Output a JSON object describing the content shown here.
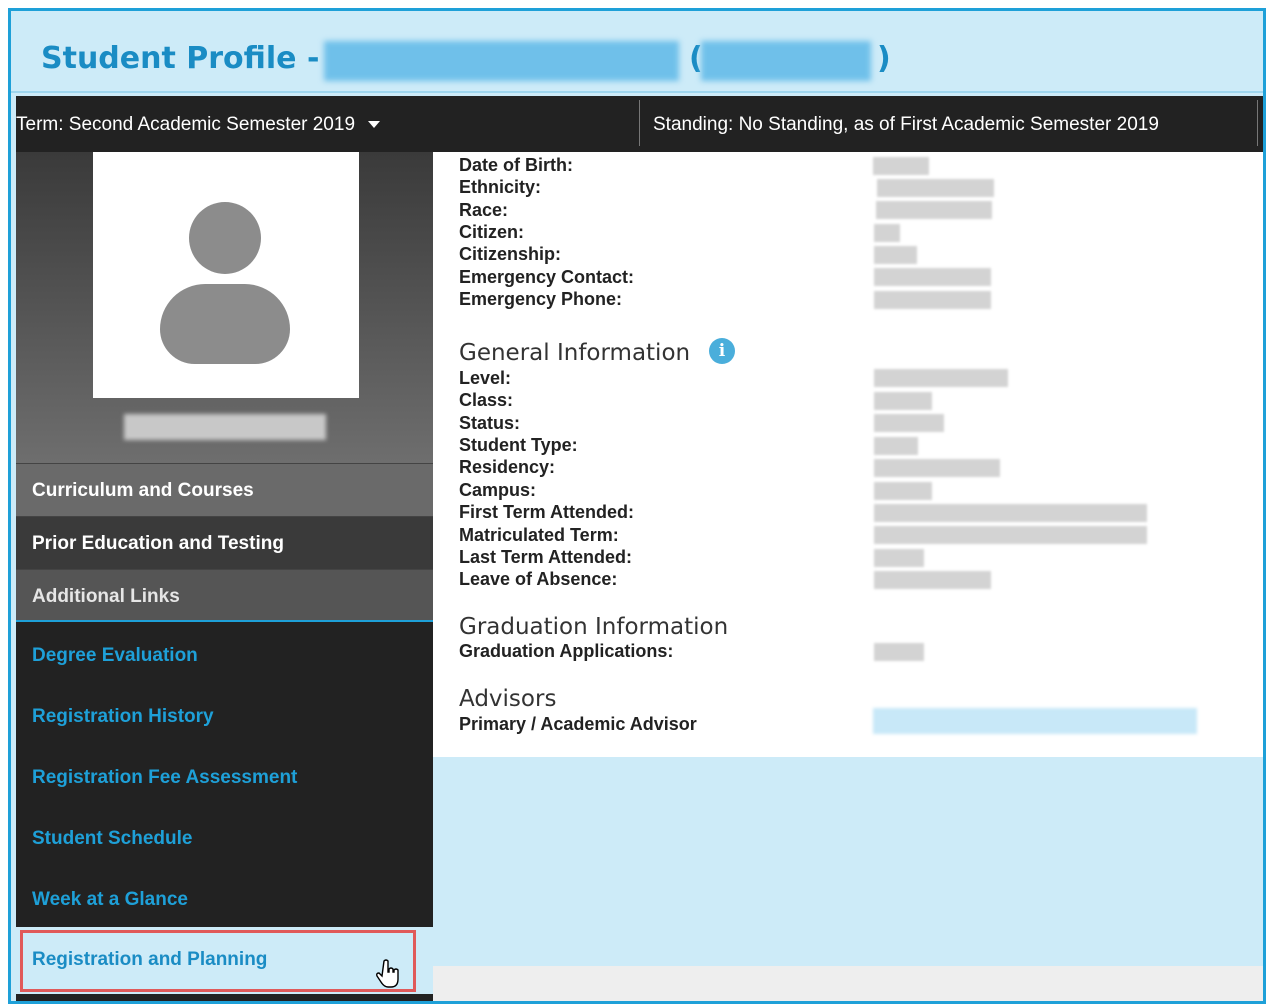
{
  "header": {
    "title_prefix": "Student Profile -",
    "paren_open": "(",
    "paren_close": ")"
  },
  "info_bar": {
    "term_label": "Term:",
    "term_value": "Second Academic Semester 2019",
    "standing_label": "Standing:",
    "standing_value": "No Standing, as of First Academic Semester 2019"
  },
  "sidebar": {
    "buttons": [
      "Curriculum and Courses",
      "Prior Education and Testing",
      "Additional Links"
    ],
    "links": [
      "Degree Evaluation",
      "Registration History",
      "Registration Fee Assessment",
      "Student Schedule",
      "Week at a Glance",
      "Registration and Planning"
    ]
  },
  "personal": {
    "labels": [
      "Date of Birth:",
      "Ethnicity:",
      "Race:",
      "Citizen:",
      "Citizenship:",
      "Emergency Contact:",
      "Emergency Phone:"
    ]
  },
  "general": {
    "heading": "General Information",
    "info_icon": "i",
    "labels": [
      "Level:",
      "Class:",
      "Status:",
      "Student Type:",
      "Residency:",
      "Campus:",
      "First Term Attended:",
      "Matriculated Term:",
      "Last Term Attended:",
      "Leave of Absence:"
    ]
  },
  "graduation": {
    "heading": "Graduation Information",
    "labels": [
      "Graduation Applications:"
    ]
  },
  "advisors": {
    "heading": "Advisors",
    "labels": [
      "Primary / Academic Advisor"
    ]
  },
  "colors": {
    "accent": "#1ea0d8",
    "header_bg": "#cdebf8",
    "sidebar_bg": "#222222",
    "highlight_outline": "#e05a5a"
  },
  "icons": {
    "term_dropdown": "caret-down-icon",
    "info": "info-icon",
    "avatar": "user-placeholder-icon",
    "pointer": "hand-pointer-icon"
  }
}
